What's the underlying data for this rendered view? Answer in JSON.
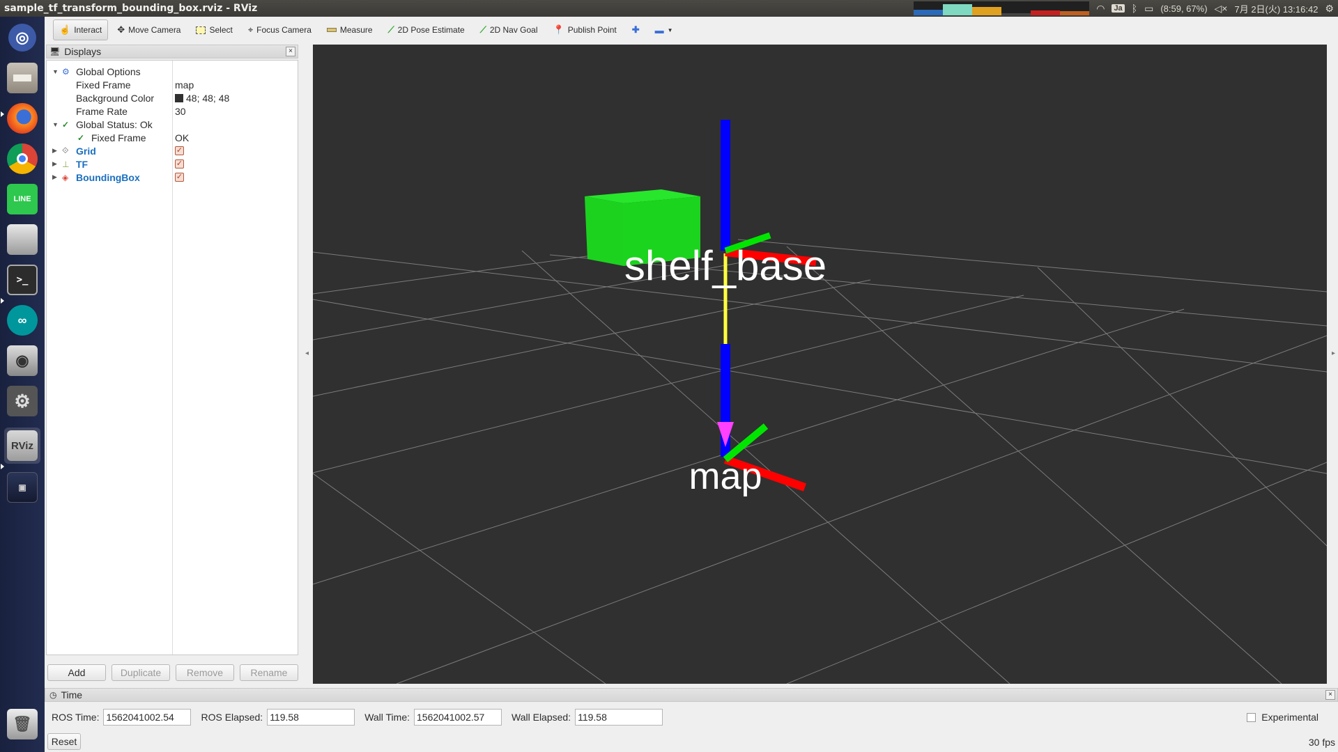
{
  "window": {
    "title": "sample_tf_transform_bounding_box.rviz - RViz"
  },
  "system_tray": {
    "input_method": "Ja",
    "battery": "(8:59, 67%)",
    "datetime": "7月 2日(火) 13:16:42"
  },
  "launcher": {
    "items": [
      {
        "name": "dash-home",
        "label": ""
      },
      {
        "name": "files",
        "label": ""
      },
      {
        "name": "firefox",
        "label": ""
      },
      {
        "name": "chrome",
        "label": ""
      },
      {
        "name": "line",
        "label": "LINE"
      },
      {
        "name": "disks",
        "label": ""
      },
      {
        "name": "terminal",
        "label": ">_"
      },
      {
        "name": "arduino",
        "label": ""
      },
      {
        "name": "camera",
        "label": ""
      },
      {
        "name": "settings",
        "label": ""
      },
      {
        "name": "rviz",
        "label": "RViz"
      },
      {
        "name": "workspaces",
        "label": ""
      },
      {
        "name": "trash",
        "label": ""
      }
    ]
  },
  "toolbar": {
    "interact": "Interact",
    "move_camera": "Move Camera",
    "select": "Select",
    "focus_camera": "Focus Camera",
    "measure": "Measure",
    "pose_estimate": "2D Pose Estimate",
    "nav_goal": "2D Nav Goal",
    "publish_point": "Publish Point"
  },
  "displays": {
    "title": "Displays",
    "global_options": "Global Options",
    "fixed_frame_label": "Fixed Frame",
    "fixed_frame_value": "map",
    "background_color_label": "Background Color",
    "background_color_value": "48; 48; 48",
    "frame_rate_label": "Frame Rate",
    "frame_rate_value": "30",
    "global_status": "Global Status: Ok",
    "status_fixed_frame_label": "Fixed Frame",
    "status_fixed_frame_value": "OK",
    "grid": "Grid",
    "tf": "TF",
    "bounding_box": "BoundingBox",
    "buttons": {
      "add": "Add",
      "duplicate": "Duplicate",
      "remove": "Remove",
      "rename": "Rename"
    }
  },
  "viewport": {
    "background": "#303030",
    "labels": {
      "shelf": "shelf_base",
      "map": "map"
    }
  },
  "time_panel": {
    "title": "Time",
    "ros_time_label": "ROS Time:",
    "ros_time": "1562041002.54",
    "ros_elapsed_label": "ROS Elapsed:",
    "ros_elapsed": "119.58",
    "wall_time_label": "Wall Time:",
    "wall_time": "1562041002.57",
    "wall_elapsed_label": "Wall Elapsed:",
    "wall_elapsed": "119.58",
    "experimental": "Experimental",
    "reset": "Reset",
    "fps": "30 fps"
  }
}
